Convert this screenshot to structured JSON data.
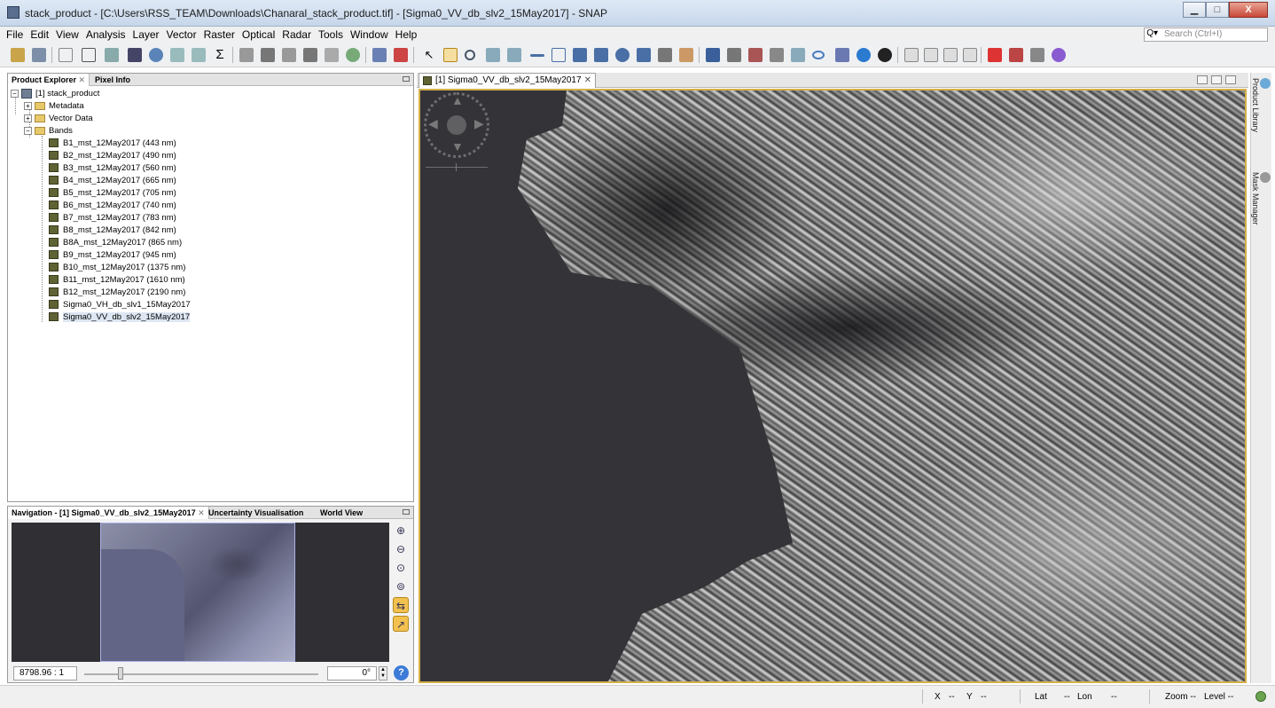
{
  "window": {
    "title": "stack_product - [C:\\Users\\RSS_TEAM\\Downloads\\Chanaral_stack_product.tif] - [Sigma0_VV_db_slv2_15May2017] - SNAP",
    "minimize": "▁",
    "maximize": "□",
    "close": "X"
  },
  "menu": [
    "File",
    "Edit",
    "View",
    "Analysis",
    "Layer",
    "Vector",
    "Raster",
    "Optical",
    "Radar",
    "Tools",
    "Window",
    "Help"
  ],
  "search": {
    "placeholder": "Search (Ctrl+I)"
  },
  "product_explorer": {
    "tabs": [
      "Product Explorer",
      "Pixel Info"
    ],
    "root": "[1] stack_product",
    "folders": [
      "Metadata",
      "Vector Data",
      "Bands"
    ],
    "bands": [
      "B1_mst_12May2017 (443 nm)",
      "B2_mst_12May2017 (490 nm)",
      "B3_mst_12May2017 (560 nm)",
      "B4_mst_12May2017 (665 nm)",
      "B5_mst_12May2017 (705 nm)",
      "B6_mst_12May2017 (740 nm)",
      "B7_mst_12May2017 (783 nm)",
      "B8_mst_12May2017 (842 nm)",
      "B8A_mst_12May2017 (865 nm)",
      "B9_mst_12May2017 (945 nm)",
      "B10_mst_12May2017 (1375 nm)",
      "B11_mst_12May2017 (1610 nm)",
      "B12_mst_12May2017 (2190 nm)",
      "Sigma0_VH_db_slv1_15May2017",
      "Sigma0_VV_db_slv2_15May2017"
    ],
    "selected_band": "Sigma0_VV_db_slv2_15May2017"
  },
  "navigation": {
    "tabs": [
      "Navigation - [1] Sigma0_VV_db_slv2_15May2017",
      "Uncertainty Visualisation",
      "World View"
    ],
    "scale": "8798.96 : 1",
    "rotation": "0°",
    "tool_icons": [
      "zoom-in-icon",
      "zoom-out-icon",
      "zoom-pixel-icon",
      "zoom-all-icon",
      "sync-views-icon",
      "sync-cursor-icon"
    ]
  },
  "image_view": {
    "tab_label": "[1] Sigma0_VV_db_slv2_15May2017",
    "tab_close": "✕"
  },
  "right_sidebar": [
    "Product Library",
    "Mask Manager"
  ],
  "status": {
    "x": "X",
    "x_val": "--",
    "y": "Y",
    "y_val": "--",
    "lat": "Lat",
    "lat_val": "--",
    "lon": "Lon",
    "lon_val": "--",
    "zoom": "Zoom --",
    "level": "Level --"
  },
  "colors": {
    "accent_border": "#d3b14a",
    "toolbar_bg": "#eef0f2",
    "sea": "#343438"
  }
}
